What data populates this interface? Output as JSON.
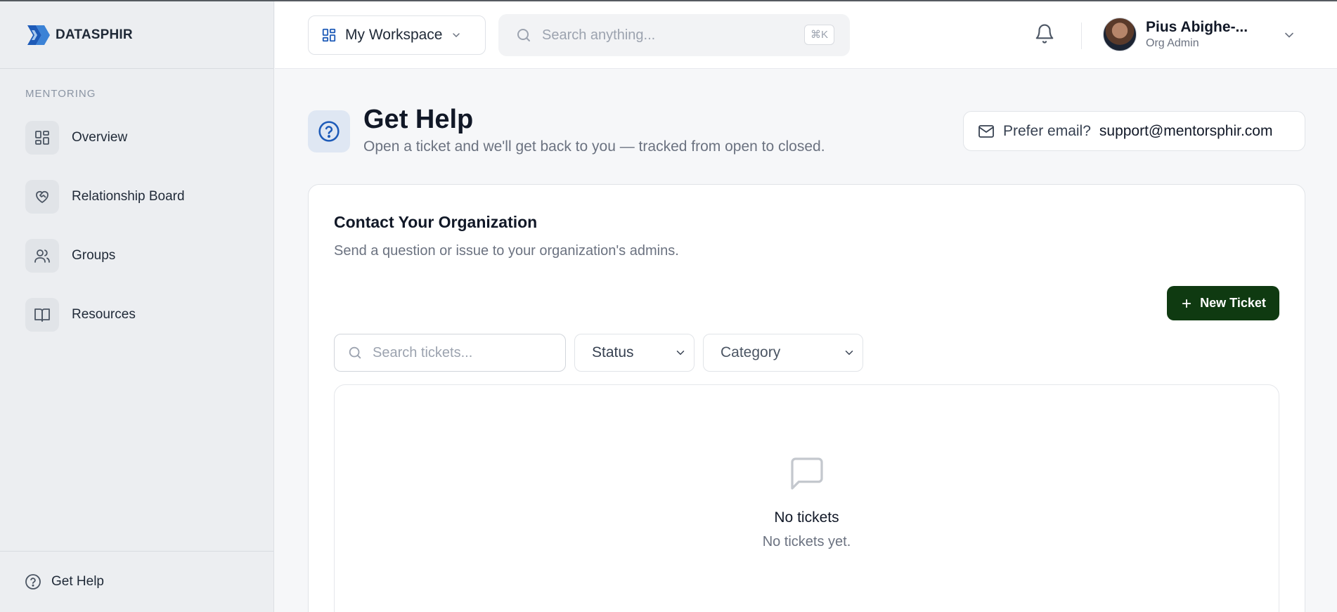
{
  "brand": {
    "name": "DATASPHIR",
    "logo_icon": "datasphir-logo"
  },
  "sidebar": {
    "section_label": "MENTORING",
    "items": [
      {
        "label": "Overview",
        "icon": "grid-icon"
      },
      {
        "label": "Relationship Board",
        "icon": "heart-handshake-icon"
      },
      {
        "label": "Groups",
        "icon": "users-icon"
      },
      {
        "label": "Resources",
        "icon": "book-open-icon"
      }
    ],
    "footer": {
      "label": "Get Help",
      "icon": "help-circle-icon"
    }
  },
  "topbar": {
    "workspace_label": "My Workspace",
    "search_placeholder": "Search anything...",
    "search_shortcut": "⌘K",
    "user": {
      "name": "Pius Abighe-...",
      "role": "Org Admin"
    }
  },
  "page": {
    "title": "Get Help",
    "subtitle": "Open a ticket and we'll get back to you — tracked from open to closed.",
    "email_prefix": "Prefer email?",
    "email_address": "support@mentorsphir.com"
  },
  "card": {
    "title": "Contact Your Organization",
    "subtitle": "Send a question or issue to your organization's admins.",
    "new_ticket_label": "New Ticket",
    "search_placeholder": "Search tickets...",
    "status_label": "Status",
    "category_label": "Category",
    "empty_title": "No tickets",
    "empty_text": "No tickets yet."
  },
  "colors": {
    "accent_dark_green": "#0f3a11",
    "brand_blue": "#1e5bb8",
    "sidebar_bg": "#eceef1",
    "page_bg": "#f6f7f9"
  }
}
